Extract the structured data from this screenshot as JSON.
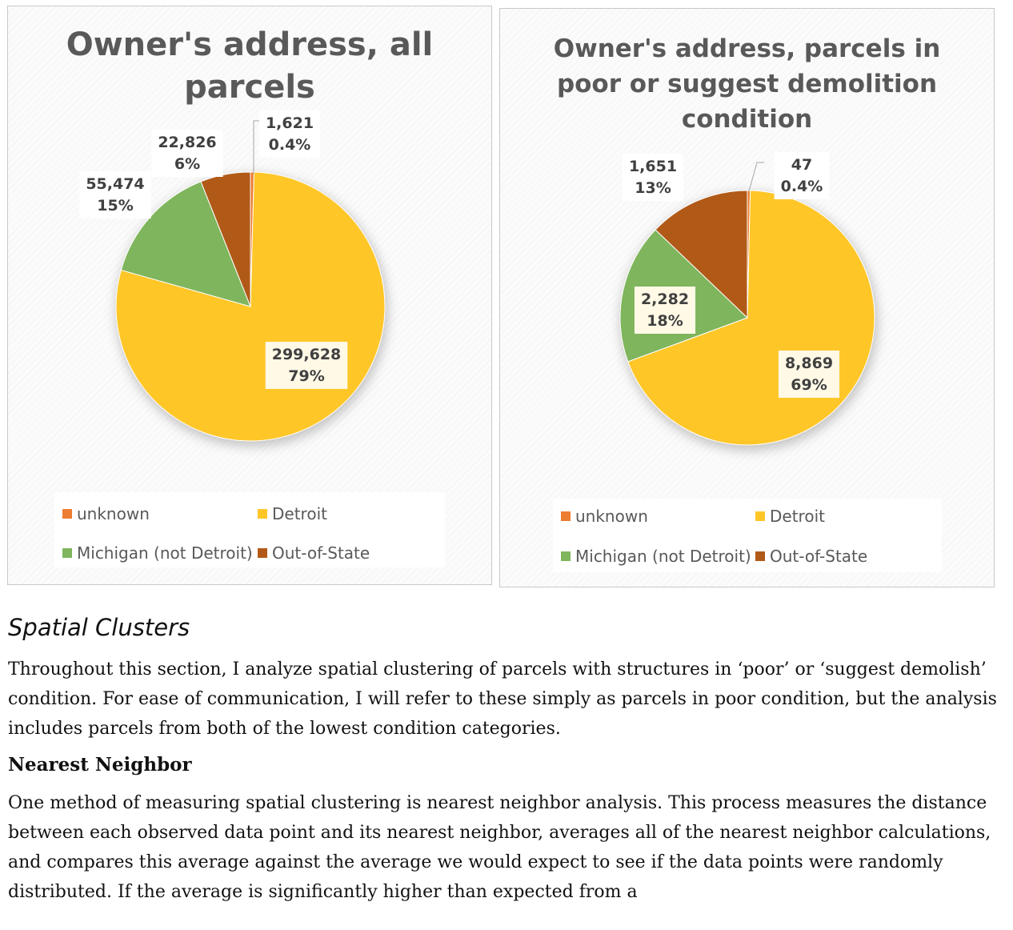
{
  "chart_data": [
    {
      "type": "pie",
      "title_lines": [
        "Owner's address, all",
        "parcels"
      ],
      "categories": [
        "unknown",
        "Detroit",
        "Michigan (not Detroit)",
        "Out-of-State"
      ],
      "values": [
        1621,
        299628,
        55474,
        22826
      ],
      "labels": [
        {
          "value": "1,621",
          "percent": "0.4%"
        },
        {
          "value": "299,628",
          "percent": "79%"
        },
        {
          "value": "55,474",
          "percent": "15%"
        },
        {
          "value": "22,826",
          "percent": "6%"
        }
      ],
      "colors": [
        "#ED7D31",
        "#FFC628",
        "#7FB55C",
        "#B15A18"
      ],
      "legend": [
        "unknown",
        "Detroit",
        "Michigan (not Detroit)",
        "Out-of-State"
      ],
      "legend_position": "bottom"
    },
    {
      "type": "pie",
      "title_lines": [
        "Owner's address, parcels in",
        "poor or suggest demolition",
        "condition"
      ],
      "categories": [
        "unknown",
        "Detroit",
        "Michigan (not Detroit)",
        "Out-of-State"
      ],
      "values": [
        47,
        8869,
        2282,
        1651
      ],
      "labels": [
        {
          "value": "47",
          "percent": "0.4%"
        },
        {
          "value": "8,869",
          "percent": "69%"
        },
        {
          "value": "2,282",
          "percent": "18%"
        },
        {
          "value": "1,651",
          "percent": "13%"
        }
      ],
      "colors": [
        "#ED7D31",
        "#FFC628",
        "#7FB55C",
        "#B15A18"
      ],
      "legend": [
        "unknown",
        "Detroit",
        "Michigan (not Detroit)",
        "Out-of-State"
      ],
      "legend_position": "bottom"
    }
  ],
  "document": {
    "section_heading": "Spatial Clusters",
    "para1": "Throughout this section, I analyze spatial clustering of parcels with structures in ‘poor’ or ‘suggest demolish’ condition. For ease of communication, I will refer to these simply as parcels in poor condition, but the analysis includes parcels from both of the lowest condition categories.",
    "sub_heading": "Nearest Neighbor",
    "para2": "One method of measuring spatial clustering is nearest neighbor analysis. This process measures the distance between each observed data point and its nearest neighbor, averages all of the nearest neighbor calculations, and compares this average against the average we would expect to see if the data points were randomly distributed. If the average is significantly higher than expected from a"
  }
}
